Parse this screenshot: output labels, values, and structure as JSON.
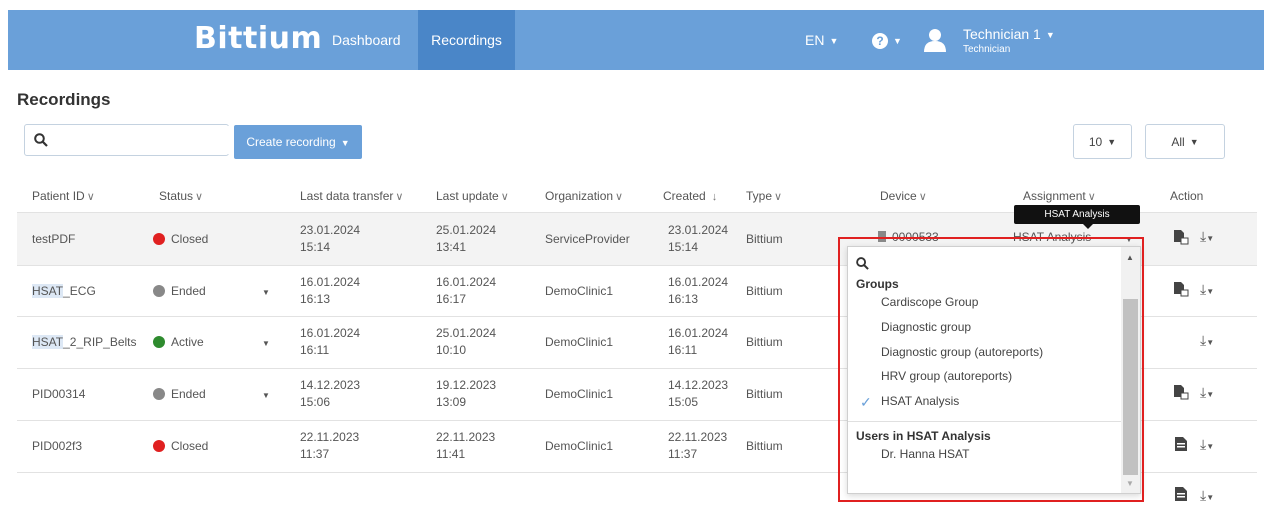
{
  "header": {
    "logo": "Bittium",
    "nav": [
      "Dashboard",
      "Recordings"
    ],
    "lang": "EN",
    "user_name": "Technician 1",
    "user_role": "Technician",
    "bar_color": "#6aa0d9",
    "active_color": "#4a86c8"
  },
  "page": {
    "title": "Recordings",
    "search_value": "",
    "create_label": "Create recording",
    "per_page": "10",
    "filter": "All"
  },
  "columns": [
    "Patient ID",
    "Status",
    "Last data transfer",
    "Last update",
    "Organization",
    "Created",
    "Type",
    "Device",
    "Assignment",
    "Action"
  ],
  "rows": [
    {
      "patient": "testPDF",
      "status": "Closed",
      "status_color": "#e02020",
      "transfer_date": "23.01.2024",
      "transfer_time": "15:14",
      "update_date": "25.01.2024",
      "update_time": "13:41",
      "org": "ServiceProvider",
      "created_date": "23.01.2024",
      "created_time": "15:14",
      "type": "Bittium",
      "device": "0000533",
      "assignment": "HSAT Analysis"
    },
    {
      "patient_hl": "HSAT",
      "patient_rest": "_ECG",
      "status": "Ended",
      "status_color": "#888888",
      "transfer_date": "16.01.2024",
      "transfer_time": "16:13",
      "update_date": "16.01.2024",
      "update_time": "16:17",
      "org": "DemoClinic1",
      "created_date": "16.01.2024",
      "created_time": "16:13",
      "type": "Bittium"
    },
    {
      "patient_hl": "HSAT",
      "patient_rest": "_2_RIP_Belts",
      "status": "Active",
      "status_color": "#2e8b2e",
      "transfer_date": "16.01.2024",
      "transfer_time": "16:11",
      "update_date": "25.01.2024",
      "update_time": "10:10",
      "org": "DemoClinic1",
      "created_date": "16.01.2024",
      "created_time": "16:11",
      "type": "Bittium"
    },
    {
      "patient": "PID00314",
      "status": "Ended",
      "status_color": "#888888",
      "transfer_date": "14.12.2023",
      "transfer_time": "15:06",
      "update_date": "19.12.2023",
      "update_time": "13:09",
      "org": "DemoClinic1",
      "created_date": "14.12.2023",
      "created_time": "15:05",
      "type": "Bittium"
    },
    {
      "patient": "PID002f3",
      "status": "Closed",
      "status_color": "#e02020",
      "transfer_date": "22.11.2023",
      "transfer_time": "11:37",
      "update_date": "22.11.2023",
      "update_time": "11:41",
      "org": "DemoClinic1",
      "created_date": "22.11.2023",
      "created_time": "11:37",
      "type": "Bittium"
    }
  ],
  "tooltip": "HSAT Analysis",
  "dropdown": {
    "groups_header": "Groups",
    "groups": [
      "Cardiscope Group",
      "Diagnostic group",
      "Diagnostic group (autoreports)",
      "HRV group (autoreports)",
      "HSAT Analysis"
    ],
    "selected": "HSAT Analysis",
    "users_header": "Users in HSAT Analysis",
    "users": [
      "Dr. Hanna HSAT"
    ]
  }
}
